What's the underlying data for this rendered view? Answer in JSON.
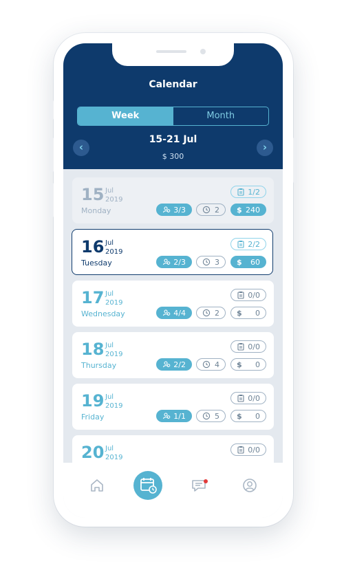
{
  "header": {
    "title": "Calendar",
    "tabs": [
      {
        "label": "Week",
        "active": true
      },
      {
        "label": "Month",
        "active": false
      }
    ],
    "range": "15-21 Jul",
    "total": "$ 300",
    "prev_icon": "chevron-left-icon",
    "next_icon": "chevron-right-icon"
  },
  "days": [
    {
      "day": "15",
      "month": "Jul",
      "year": "2019",
      "name": "Monday",
      "state": "past",
      "tasks": "1/2",
      "bookings": "3/3",
      "hours": "2",
      "amount": "240"
    },
    {
      "day": "16",
      "month": "Jul",
      "year": "2019",
      "name": "Tuesday",
      "state": "selected",
      "tasks": "2/2",
      "bookings": "2/3",
      "hours": "3",
      "amount": "60"
    },
    {
      "day": "17",
      "month": "Jul",
      "year": "2019",
      "name": "Wednesday",
      "state": "upcoming",
      "tasks": "0/0",
      "bookings": "4/4",
      "hours": "2",
      "amount": "0"
    },
    {
      "day": "18",
      "month": "Jul",
      "year": "2019",
      "name": "Thursday",
      "state": "upcoming",
      "tasks": "0/0",
      "bookings": "2/2",
      "hours": "4",
      "amount": "0"
    },
    {
      "day": "19",
      "month": "Jul",
      "year": "2019",
      "name": "Friday",
      "state": "upcoming",
      "tasks": "0/0",
      "bookings": "1/1",
      "hours": "5",
      "amount": "0"
    },
    {
      "day": "20",
      "month": "Jul",
      "year": "2019",
      "name": "",
      "state": "upcoming",
      "tasks": "0/0",
      "bookings": "",
      "hours": "",
      "amount": ""
    }
  ],
  "currency_symbol": "$",
  "tabbar": {
    "items": [
      {
        "icon": "home-icon",
        "active": false
      },
      {
        "icon": "calendar-icon",
        "active": true
      },
      {
        "icon": "chat-icon",
        "active": false,
        "badge": true
      },
      {
        "icon": "profile-icon",
        "active": false
      }
    ]
  },
  "colors": {
    "navy": "#0e3a6c",
    "accent": "#56b3d1",
    "background": "#e4e9ef",
    "badge": "#e23b3b"
  }
}
